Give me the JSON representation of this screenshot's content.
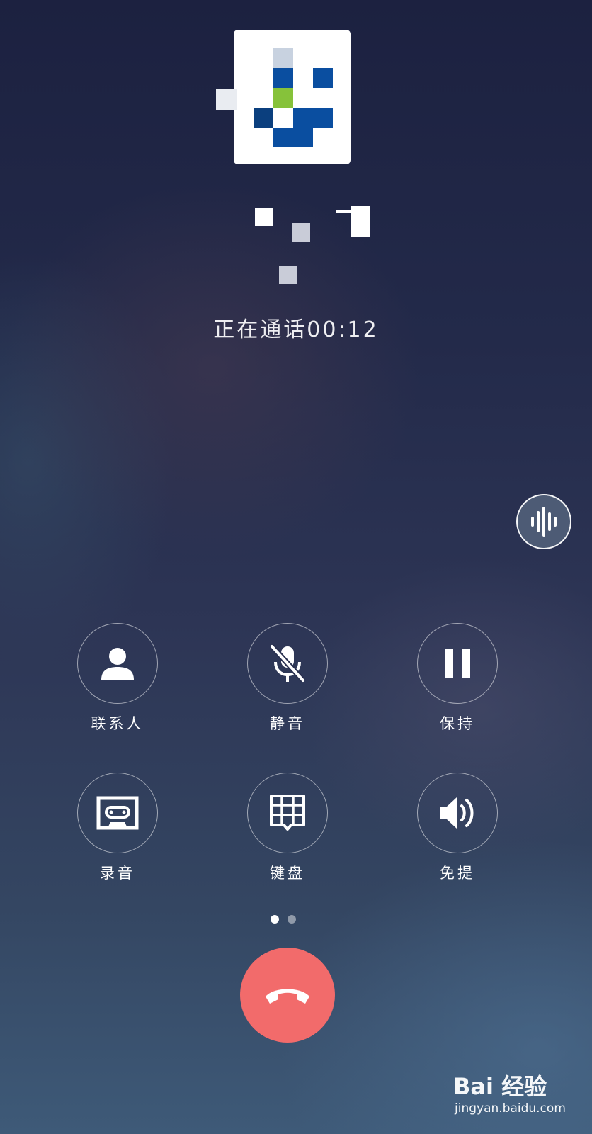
{
  "call": {
    "status_text": "正在通话00:12"
  },
  "controls": [
    {
      "label": "联系人",
      "icon": "person-icon"
    },
    {
      "label": "静音",
      "icon": "mic-off-icon"
    },
    {
      "label": "保持",
      "icon": "pause-icon"
    },
    {
      "label": "录音",
      "icon": "cassette-icon"
    },
    {
      "label": "键盘",
      "icon": "keypad-icon"
    },
    {
      "label": "免提",
      "icon": "speaker-icon"
    }
  ],
  "pager": {
    "pages": 2,
    "current": 1
  },
  "hangup": {
    "icon": "hang-up-icon",
    "color": "#f26b6b"
  },
  "floating_button": {
    "icon": "voice-wave-icon"
  },
  "watermark": {
    "brand": "Bai 经验",
    "url": "jingyan.baidu.com"
  },
  "colors": {
    "accent_end_call": "#f26b6b",
    "text": "#ffffff"
  }
}
